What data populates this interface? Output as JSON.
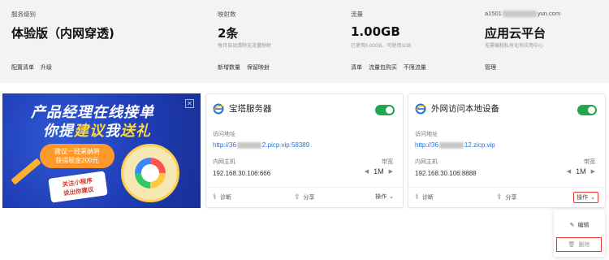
{
  "stats": [
    {
      "label": "服务级别",
      "value": "体验版（内网穿透)",
      "sub": "",
      "links": [
        "配置清单",
        "升级"
      ]
    },
    {
      "label": "映射数",
      "value": "2条",
      "sub": "每月自动清除无流量映射",
      "links": [
        "新增数量",
        "保留映射"
      ]
    },
    {
      "label": "流量",
      "value": "1.00GB",
      "sub": "已使用0.00GB，可使用1GB",
      "links": [
        "清单",
        "流量包购买",
        "不限流量"
      ]
    },
    {
      "label_prefix": "a1501",
      "label_suffix": "yun.com",
      "value": "应用云平台",
      "sub": "无需编程私有化有应用中心",
      "links": [
        "管理"
      ]
    }
  ],
  "banner": {
    "line1": "产品经理在线接单",
    "line2_a": "你提",
    "line2_b": "建议",
    "line2_c": "我",
    "line2_d": "送礼",
    "pill_line1": "建议一经采纳将",
    "pill_line2": "获得现金200元",
    "mini_line1": "关注小程序",
    "mini_line2": "说出你建议",
    "close": "✕"
  },
  "cards": [
    {
      "title": "宝塔服务器",
      "access_label": "访问地址",
      "url_prefix": "http://36",
      "url_suffix": "2.picp.vip:58389",
      "host_label": "内网主机",
      "host": "192.168.30.106:666",
      "bw_label": "带宽",
      "bw": "1M",
      "diagnose": "诊断",
      "share": "分享",
      "ops": "操作"
    },
    {
      "title": "外网访问本地设备",
      "access_label": "访问地址",
      "url_prefix": "http://36",
      "url_suffix": "12.zicp.vip",
      "host_label": "内网主机",
      "host": "192.168.30.106:8888",
      "bw_label": "带宽",
      "bw": "1M",
      "diagnose": "诊断",
      "share": "分享",
      "ops": "操作"
    }
  ],
  "dropdown": {
    "edit": "编辑",
    "delete": "删除"
  },
  "colors": {
    "accent": "#22a74f",
    "link": "#2a6fd6",
    "highlight": "#e3342f"
  }
}
